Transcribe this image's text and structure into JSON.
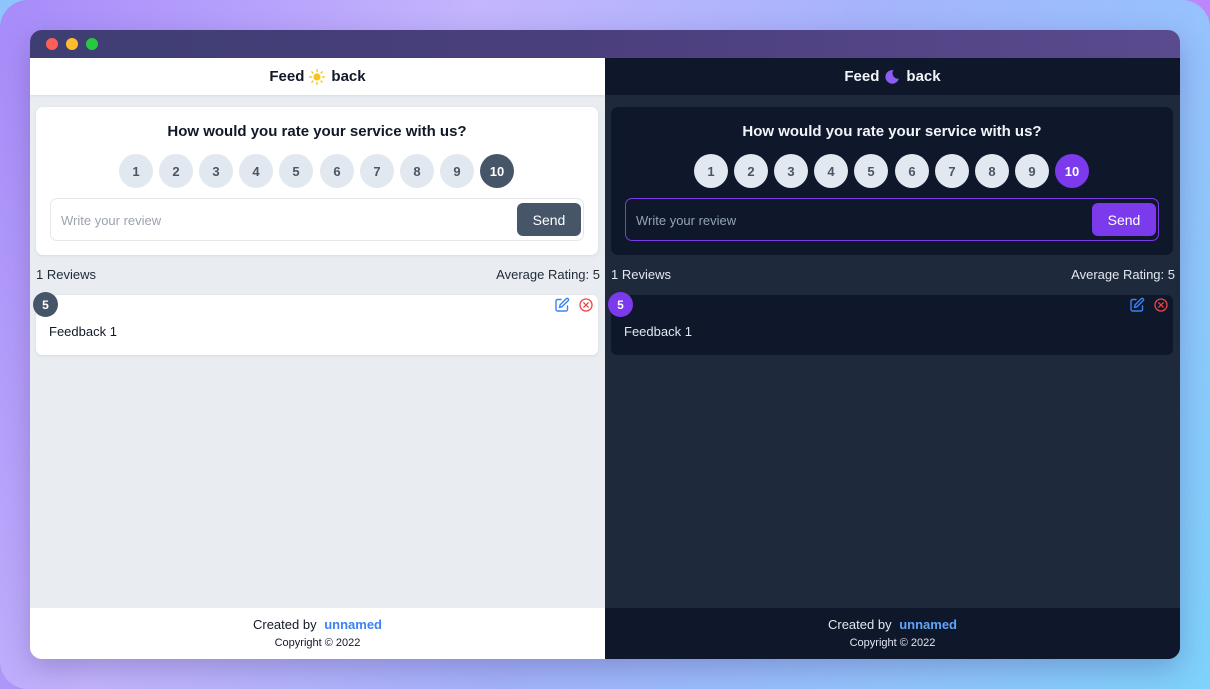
{
  "app": {
    "title_prefix": "Feed",
    "title_suffix": "back"
  },
  "colors": {
    "light_accent": "#475569",
    "dark_accent": "#7c3aed",
    "link": "#3b82f6"
  },
  "form": {
    "question": "How would you rate your service with us?",
    "ratings": [
      "1",
      "2",
      "3",
      "4",
      "5",
      "6",
      "7",
      "8",
      "9",
      "10"
    ],
    "selected_rating": "10",
    "review_placeholder": "Write your review",
    "review_value": "",
    "send_label": "Send"
  },
  "stats": {
    "reviews_count": "1 Reviews",
    "average_rating": "Average Rating: 5"
  },
  "feedback": [
    {
      "rating": "5",
      "text": "Feedback 1"
    }
  ],
  "footer": {
    "created_by": "Created by",
    "author": "unnamed",
    "copyright": "Copyright © 2022"
  },
  "icons": {
    "light_logo": "sun-icon",
    "dark_logo": "moon-icon",
    "edit": "edit-icon",
    "delete": "delete-icon"
  }
}
